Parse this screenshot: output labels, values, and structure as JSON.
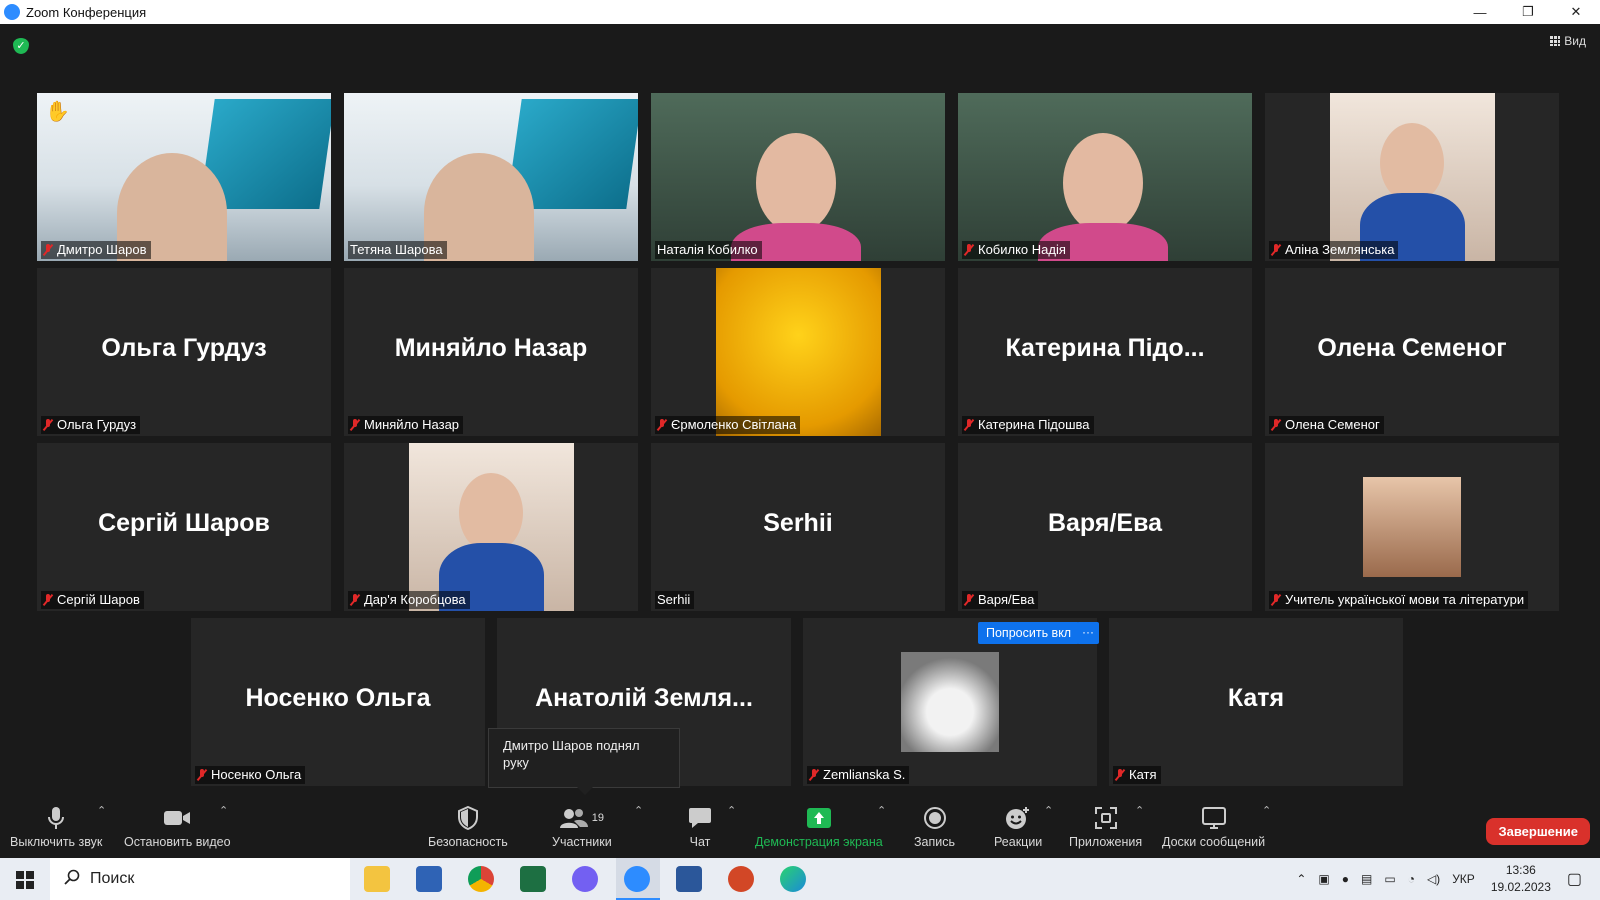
{
  "window": {
    "title": "Zoom Конференция"
  },
  "view_button": {
    "label": "Вид"
  },
  "participants": [
    {
      "big_name": "",
      "label": "Дмитро Шаров",
      "muted": true,
      "video": "room",
      "hand": true
    },
    {
      "big_name": "",
      "label": "Тетяна Шарова",
      "muted": false,
      "video": "room"
    },
    {
      "big_name": "",
      "label": "Наталія Кобилко",
      "muted": false,
      "video": "face",
      "active": true
    },
    {
      "big_name": "",
      "label": "Кобилко Надія",
      "muted": true,
      "video": "face"
    },
    {
      "big_name": "",
      "label": "Аліна Землянська",
      "muted": true,
      "video": "photo"
    },
    {
      "big_name": "Ольга Гурдуз",
      "label": "Ольга Гурдуз",
      "muted": true
    },
    {
      "big_name": "Миняйло  Назар",
      "label": "Миняйло  Назар",
      "muted": true
    },
    {
      "big_name": "",
      "label": "Єрмоленко Світлана",
      "muted": true,
      "video": "tulip"
    },
    {
      "big_name": "Катерина  Підо...",
      "label": "Катерина Підошва",
      "muted": true
    },
    {
      "big_name": "Олена Семеног",
      "label": "Олена Семеног",
      "muted": true
    },
    {
      "big_name": "Сергій Шаров",
      "label": "Сергій Шаров",
      "muted": true
    },
    {
      "big_name": "",
      "label": "Дар'я Коробцова",
      "muted": true,
      "video": "photo"
    },
    {
      "big_name": "Serhii",
      "label": "Serhii",
      "muted": false
    },
    {
      "big_name": "Варя/Ева",
      "label": "Варя/Ева",
      "muted": true
    },
    {
      "big_name": "",
      "label": "Учитель української мови та літератури",
      "muted": true,
      "video": "smallphoto"
    },
    {
      "big_name": "Носенко Ольга",
      "label": "Носенко Ольга",
      "muted": true
    },
    {
      "big_name": "Анатолій  Земля...",
      "label": "",
      "muted": false
    },
    {
      "big_name": "",
      "label": "Zemlianska S.",
      "muted": true,
      "video": "toy"
    },
    {
      "big_name": "Катя",
      "label": "Катя",
      "muted": true
    }
  ],
  "ask_unmute": {
    "label": "Попросить вкл",
    "more": "···"
  },
  "tooltip": {
    "text": "Дмитро Шаров поднял руку"
  },
  "toolbar": {
    "mute": "Выключить звук",
    "video": "Остановить видео",
    "security": "Безопасность",
    "participants": "Участники",
    "participants_count": "19",
    "chat": "Чат",
    "share": "Демонстрация экрана",
    "record": "Запись",
    "reactions": "Реакции",
    "apps": "Приложения",
    "whiteboards": "Доски сообщений",
    "end": "Завершение"
  },
  "taskbar": {
    "search_placeholder": "Поиск",
    "language": "УКР",
    "time": "13:36",
    "date": "19.02.2023"
  },
  "colors": {
    "active_speaker": "#e8e36e",
    "share_green": "#1fb954",
    "end_red": "#d9312b",
    "mute_red": "#e02828"
  }
}
